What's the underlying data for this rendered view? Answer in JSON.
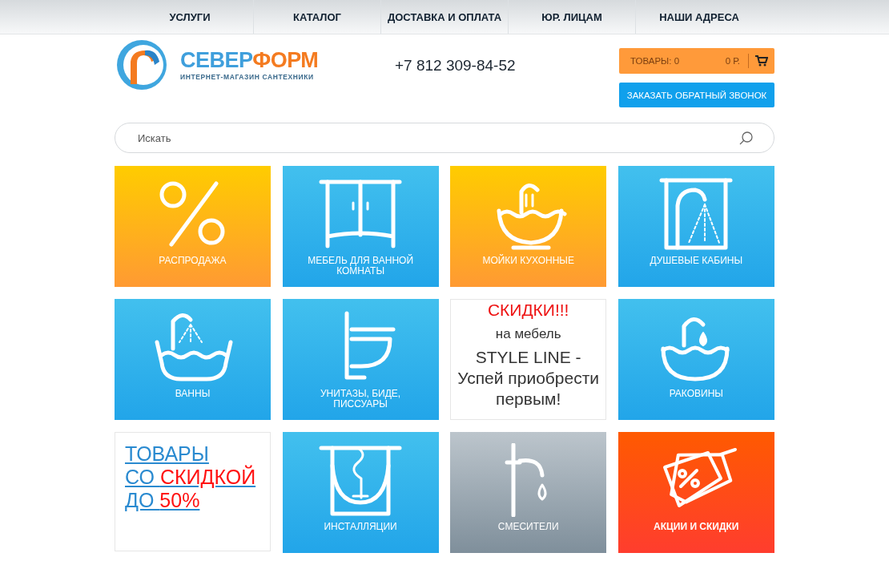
{
  "nav": [
    {
      "label": "УСЛУГИ"
    },
    {
      "label": "КАТАЛОГ"
    },
    {
      "label": "ДОСТАВКА И ОПЛАТА"
    },
    {
      "label": "ЮР. ЛИЦАМ"
    },
    {
      "label": "НАШИ АДРЕСА"
    }
  ],
  "logo": {
    "name_first": "СЕВЕР",
    "name_second": "ФОРМ",
    "tagline": "ИНТЕРНЕТ-МАГАЗИН САНТЕХНИКИ"
  },
  "phone": "+7 812 309-84-52",
  "cart": {
    "items": "ТОВАРЫ: 0",
    "total": "0 Р."
  },
  "callback_button": "ЗАКАЗАТЬ ОБРАТНЫЙ ЗВОНОК",
  "search": {
    "placeholder": "Искать"
  },
  "tiles": [
    {
      "kind": "category",
      "label": "РАСПРОДАЖА",
      "emphasis": false
    },
    {
      "kind": "category",
      "label": "МЕБЕЛЬ ДЛЯ ВАННОЙ КОМНАТЫ",
      "emphasis": false
    },
    {
      "kind": "category",
      "label": "МОЙКИ КУХОННЫЕ",
      "emphasis": false
    },
    {
      "kind": "category",
      "label": "ДУШЕВЫЕ КАБИНЫ",
      "emphasis": false
    },
    {
      "kind": "category",
      "label": "ВАННЫ",
      "emphasis": false
    },
    {
      "kind": "category",
      "label": "УНИТАЗЫ, БИДЕ, ПИССУАРЫ",
      "emphasis": false
    },
    {
      "kind": "banner",
      "lines": [
        "СКИДКИ!!!",
        "на мебель",
        "STYLE LINE -",
        "Успей приобрести",
        "первым!"
      ]
    },
    {
      "kind": "category",
      "label": "РАКОВИНЫ",
      "emphasis": false
    },
    {
      "kind": "link",
      "lines": [
        [
          {
            "text": "ТОВАРЫ",
            "accent": false
          }
        ],
        [
          {
            "text": "СО ",
            "accent": false
          },
          {
            "text": "СКИДКОЙ",
            "accent": true
          }
        ],
        [
          {
            "text": "ДО ",
            "accent": false
          },
          {
            "text": "50%",
            "accent": true
          }
        ]
      ]
    },
    {
      "kind": "category",
      "label": "ИНСТАЛЛЯЦИИ",
      "emphasis": false
    },
    {
      "kind": "category",
      "label": "СМЕСИТЕЛИ",
      "emphasis": false
    },
    {
      "kind": "category",
      "label": "АКЦИИ И СКИДКИ",
      "emphasis": true
    }
  ]
}
